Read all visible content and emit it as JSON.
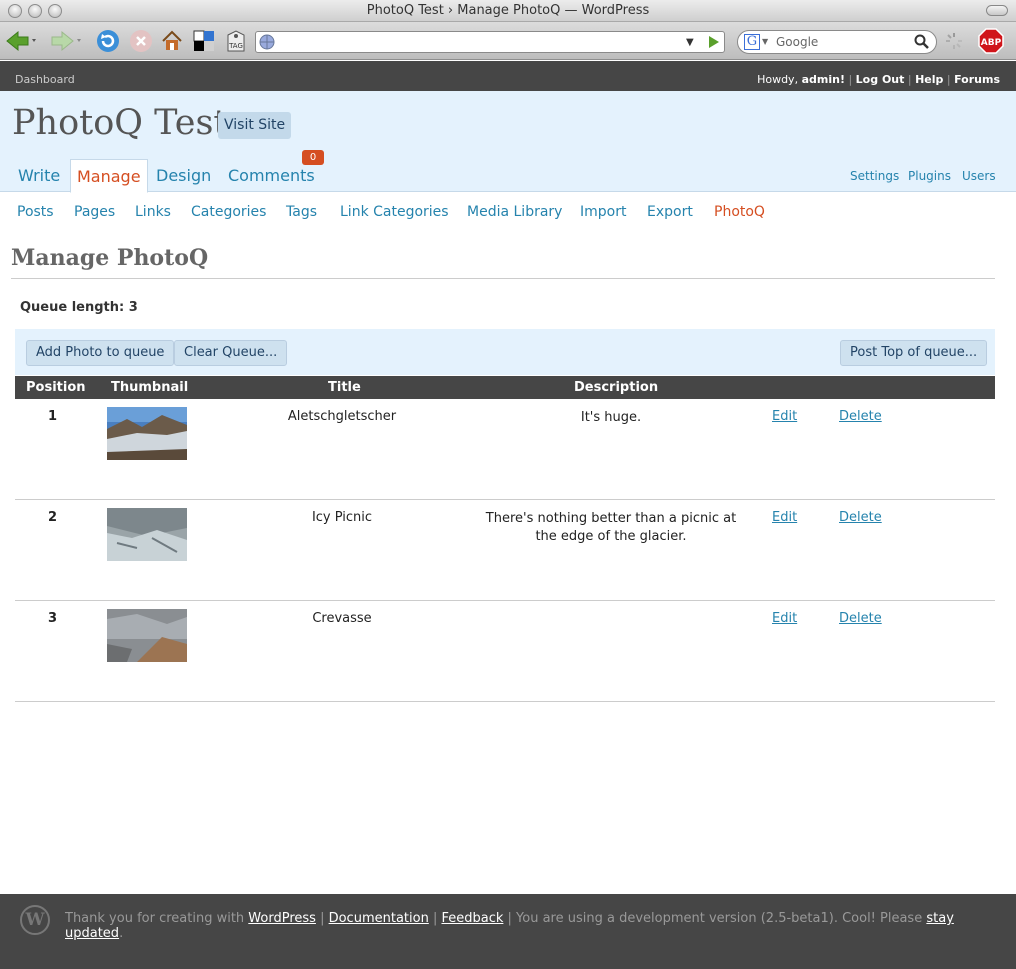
{
  "window": {
    "title": "PhotoQ Test › Manage PhotoQ — WordPress"
  },
  "browser": {
    "search_placeholder": "Google",
    "url": ""
  },
  "userbar": {
    "dashboard": "Dashboard",
    "howdy": "Howdy,",
    "user": "admin!",
    "links": [
      "Log Out",
      "Help",
      "Forums"
    ]
  },
  "site": {
    "title": "PhotoQ Test",
    "visit_button": "Visit Site"
  },
  "main_tabs": [
    "Write",
    "Manage",
    "Design",
    "Comments"
  ],
  "comment_count": "0",
  "right_links": [
    "Settings",
    "Plugins",
    "Users"
  ],
  "subnav": [
    "Posts",
    "Pages",
    "Links",
    "Categories",
    "Tags",
    "Link Categories",
    "Media Library",
    "Import",
    "Export",
    "PhotoQ"
  ],
  "page": {
    "title": "Manage PhotoQ",
    "queue_length": "Queue length: 3"
  },
  "actions": {
    "add": "Add Photo to queue",
    "clear": "Clear Queue...",
    "post_top": "Post Top of queue..."
  },
  "table": {
    "columns": [
      "Position",
      "Thumbnail",
      "Title",
      "Description"
    ],
    "rows": [
      {
        "position": "1",
        "title": "Aletschgletscher",
        "description": "It's huge.",
        "edit": "Edit",
        "delete": "Delete"
      },
      {
        "position": "2",
        "title": "Icy Picnic",
        "description": "There's nothing better than a picnic at the edge of the glacier.",
        "edit": "Edit",
        "delete": "Delete"
      },
      {
        "position": "3",
        "title": "Crevasse",
        "description": "",
        "edit": "Edit",
        "delete": "Delete"
      }
    ]
  },
  "footer": {
    "thank_you": "Thank you for creating with",
    "wordpress": "WordPress",
    "documentation": "Documentation",
    "feedback": "Feedback",
    "dev_note": "You are using a development version (2.5-beta1). Cool! Please",
    "stay_updated": "stay updated",
    "period": "."
  },
  "colors": {
    "accent": "#d54e21",
    "link": "#2583ad",
    "header_bg": "#e4f2fd",
    "dark_bar": "#464646"
  }
}
